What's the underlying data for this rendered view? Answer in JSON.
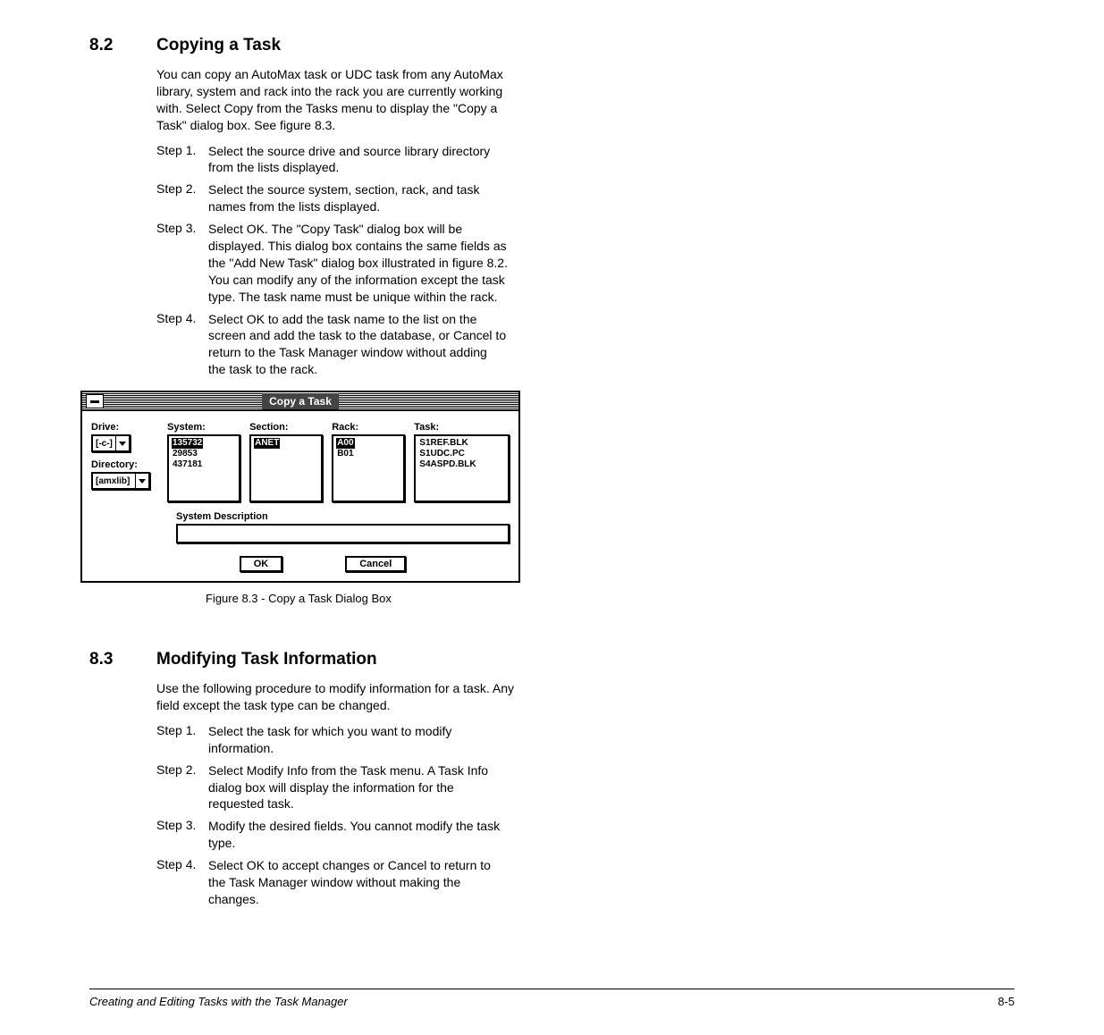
{
  "section_82": {
    "number": "8.2",
    "title": "Copying a Task",
    "intro": "You can copy an AutoMax task or UDC task from any AutoMax library, system and rack into the rack you are currently working with. Select Copy from the Tasks menu to display the \"Copy a Task\" dialog box. See figure 8.3.",
    "steps": [
      {
        "label": "Step 1.",
        "text": "Select the source drive and source library directory from the lists displayed."
      },
      {
        "label": "Step 2.",
        "text": "Select the source system, section, rack, and task names from the lists displayed."
      },
      {
        "label": "Step 3.",
        "text": "Select OK. The \"Copy Task\" dialog box will be displayed. This dialog box contains the same fields as the \"Add New Task\" dialog box illustrated in figure 8.2. You can modify any of the information except the task type. The task name must be unique within the rack."
      },
      {
        "label": "Step 4.",
        "text": "Select OK to add the task name to the list on the screen and add the task to the database, or Cancel to return to the Task Manager window without adding the task to the rack."
      }
    ]
  },
  "figure": {
    "dialog_title": "Copy a Task",
    "drive_label": "Drive:",
    "drive_value": "[-c-]",
    "directory_label": "Directory:",
    "directory_value": "[amxlib]",
    "system_label": "System:",
    "system_items": [
      "135732",
      "29853",
      "437181"
    ],
    "section_label": "Section:",
    "section_items": [
      "ANET"
    ],
    "rack_label": "Rack:",
    "rack_items": [
      "A00",
      "B01"
    ],
    "task_label": "Task:",
    "task_items": [
      "S1REF.BLK",
      "S1UDC.PC",
      "S4ASPD.BLK"
    ],
    "sys_desc_label": "System Description",
    "ok_label": "OK",
    "cancel_label": "Cancel",
    "caption": "Figure 8.3 - Copy a Task Dialog Box"
  },
  "section_83": {
    "number": "8.3",
    "title": "Modifying Task Information",
    "intro": "Use the following procedure to modify information for a task. Any field except the task type can be changed.",
    "steps": [
      {
        "label": "Step 1.",
        "text": "Select the task for which you want to modify information."
      },
      {
        "label": "Step 2.",
        "text": "Select Modify Info from the Task menu. A Task Info dialog box will display the information for the requested task."
      },
      {
        "label": "Step 3.",
        "text": "Modify the desired fields. You cannot modify the task type."
      },
      {
        "label": "Step 4.",
        "text": "Select OK to accept changes or Cancel to return to the Task Manager window without making the changes."
      }
    ]
  },
  "footer": {
    "left": "Creating and Editing Tasks with the Task Manager",
    "right": "8-5"
  }
}
